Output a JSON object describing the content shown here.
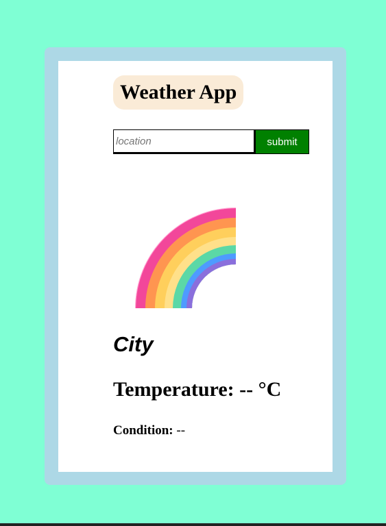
{
  "app": {
    "title": "Weather App"
  },
  "search": {
    "placeholder": "location",
    "value": "",
    "submit_label": "submit"
  },
  "weather": {
    "icon": "rainbow-icon",
    "city": "City",
    "temperature_label": "Temperature:",
    "temperature_value": "-- °C",
    "condition_label": "Condition:",
    "condition_value": "--"
  },
  "colors": {
    "page_background": "#7fffd4",
    "frame": "#add8e6",
    "card": "#ffffff",
    "title_background": "#faebd7",
    "submit_background": "#008000",
    "submit_text": "#ffffff"
  }
}
